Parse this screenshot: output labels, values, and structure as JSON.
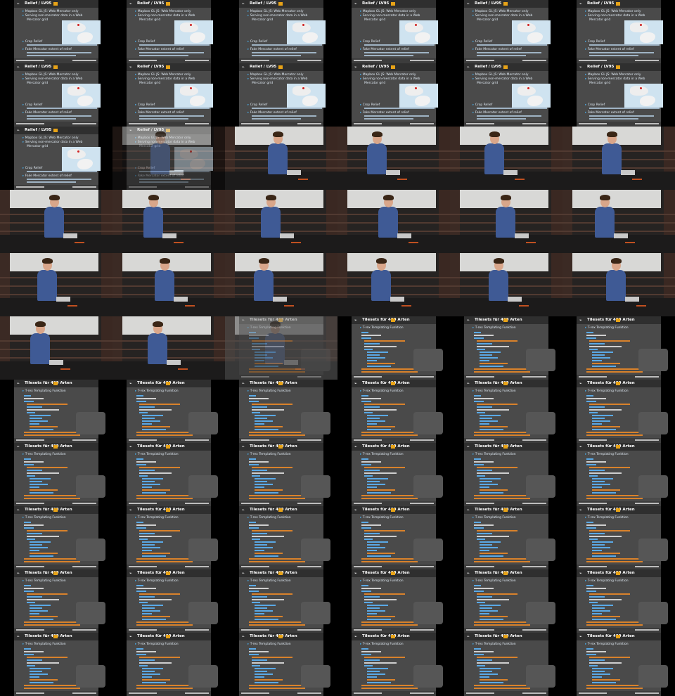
{
  "grid": {
    "columns": 6,
    "rows": 11
  },
  "labels": {
    "relief_title": "Relief / LV95",
    "relief_bullet_1": "Mapbox GL JS: Web Mercator only",
    "relief_bullet_2": "Serving non-mercator data in a Web",
    "relief_bullet_2b": "Mercator grid",
    "relief_bullet_3": "Crop Relief",
    "relief_bullet_4": "Fake Mercator extent of relief",
    "tileset_title": "Tilesets für 420 Arten",
    "trex_subtitle": "T-rex Templating Funktion"
  },
  "cells": [
    "relief",
    "relief",
    "relief",
    "relief",
    "relief",
    "relief",
    "relief",
    "relief",
    "relief",
    "relief",
    "relief",
    "relief",
    "relief",
    "relief-fade",
    "camera",
    "camera",
    "camera",
    "camera",
    "camera",
    "camera",
    "camera",
    "camera",
    "camera",
    "camera",
    "camera",
    "camera",
    "camera",
    "camera",
    "camera",
    "camera",
    "camera",
    "camera",
    "camera-fade",
    "tileset",
    "tileset",
    "tileset",
    "tileset",
    "tileset",
    "tileset",
    "tileset",
    "tileset",
    "tileset",
    "tileset",
    "tileset",
    "tileset",
    "tileset",
    "tileset",
    "tileset",
    "tileset",
    "tileset",
    "tileset",
    "tileset",
    "tileset",
    "tileset",
    "tileset",
    "tileset",
    "tileset",
    "tileset",
    "tileset",
    "tileset",
    "tileset",
    "tileset",
    "tileset",
    "tileset",
    "tileset",
    "tileset"
  ],
  "colors": {
    "slide_bg": "#4a4a4a",
    "title_bar": "#2f2f2f",
    "accent": "#4aa3d9",
    "flag": "#e8a317",
    "code_blue": "#5aa9e6",
    "code_orange": "#d9822b",
    "code_white": "#cfcfcf",
    "shirt": "#3f5a95"
  }
}
